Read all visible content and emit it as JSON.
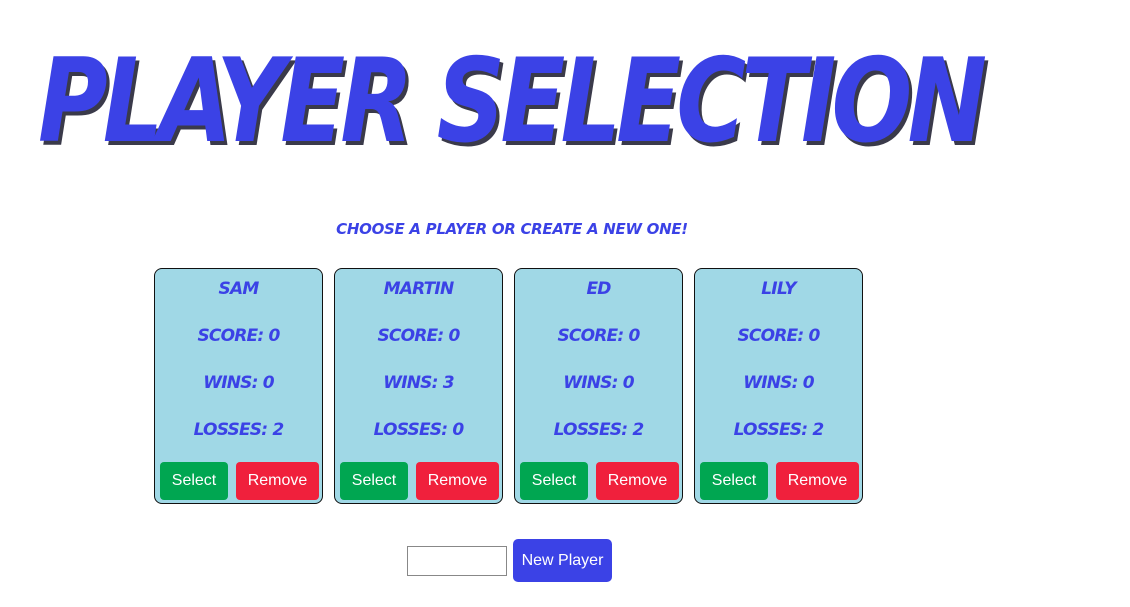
{
  "header": {
    "title": "Player Selection",
    "subtitle": "Choose a player or create a new one!"
  },
  "players": [
    {
      "name": "Sam",
      "score": "Score: 0",
      "wins": "Wins: 0",
      "losses": "Losses: 2",
      "select_label": "Select",
      "remove_label": "Remove"
    },
    {
      "name": "Martin",
      "score": "Score: 0",
      "wins": "Wins: 3",
      "losses": "Losses: 0",
      "select_label": "Select",
      "remove_label": "Remove"
    },
    {
      "name": "Ed",
      "score": "Score: 0",
      "wins": "Wins: 0",
      "losses": "Losses: 2",
      "select_label": "Select",
      "remove_label": "Remove"
    },
    {
      "name": "Lily",
      "score": "Score: 0",
      "wins": "Wins: 0",
      "losses": "Losses: 2",
      "select_label": "Select",
      "remove_label": "Remove"
    }
  ],
  "new_player": {
    "input_value": "",
    "input_placeholder": "",
    "button_label": "New Player"
  },
  "colors": {
    "accent": "#3b42e6",
    "card_bg": "#a0d8e6",
    "select_bg": "#00a651",
    "remove_bg": "#f0203c"
  }
}
